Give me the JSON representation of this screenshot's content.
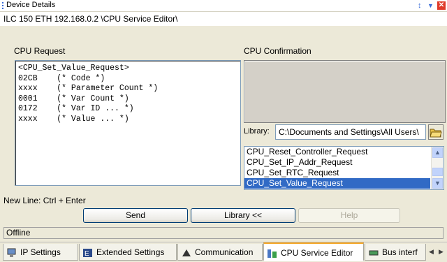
{
  "window": {
    "title": "Device Details",
    "pin_icon": "pin-icon",
    "menu_icon": "dropdown-icon",
    "close_icon": "close-icon",
    "path": "ILC 150 ETH 192.168.0.2 \\CPU Service Editor\\"
  },
  "request": {
    "label": "CPU Request",
    "text": "<CPU_Set_Value_Request>\n02CB    (* Code *)\nxxxx    (* Parameter Count *)\n0001    (* Var Count *)\n0172    (* Var ID ... *)\nxxxx    (* Value ... *)"
  },
  "confirmation": {
    "label": "CPU Confirmation"
  },
  "library": {
    "label": "Library:",
    "path_value": "C:\\Documents and Settings\\All Users\\",
    "browse_icon": "folder-open-icon",
    "items": [
      "CPU_Reset_Controller_Request",
      "CPU_Set_IP_Addr_Request",
      "CPU_Set_RTC_Request",
      "CPU_Set_Value_Request"
    ],
    "selected_index": 3
  },
  "hint": "New Line: Ctrl + Enter",
  "buttons": {
    "send": "Send",
    "library": "Library <<",
    "help": "Help"
  },
  "status": "Offline",
  "tabs": [
    {
      "label": "IP Settings",
      "icon": "network-icon"
    },
    {
      "label": "Extended Settings",
      "icon": "extended-settings-icon"
    },
    {
      "label": "Communication",
      "icon": "communication-icon"
    },
    {
      "label": "CPU Service Editor",
      "icon": "cpu-service-icon",
      "active": true
    },
    {
      "label": "Bus interf",
      "icon": "bus-interface-icon"
    }
  ],
  "colors": {
    "selection": "#316ac5",
    "active_tab_accent": "#f5a623"
  }
}
